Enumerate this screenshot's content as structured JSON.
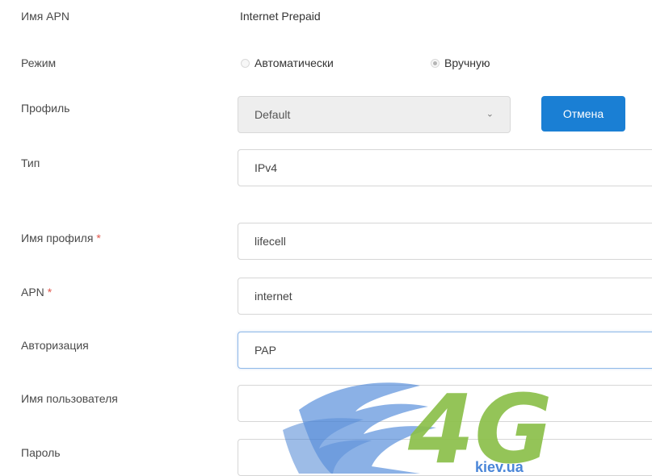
{
  "apn_name": {
    "label": "Имя APN",
    "value": "Internet Prepaid"
  },
  "mode": {
    "label": "Режим",
    "options": [
      {
        "label": "Автоматически",
        "checked": false
      },
      {
        "label": "Вручную",
        "checked": true
      }
    ]
  },
  "profile": {
    "label": "Профиль",
    "value": "Default",
    "disabled": true
  },
  "cancel_button": {
    "label": "Отмена"
  },
  "type": {
    "label": "Тип",
    "value": "IPv4"
  },
  "profile_name": {
    "label": "Имя профиля",
    "required_mark": "*",
    "value": "lifecell"
  },
  "apn": {
    "label": "APN",
    "required_mark": "*",
    "value": "internet"
  },
  "auth": {
    "label": "Авторизация",
    "value": "PAP"
  },
  "username": {
    "label": "Имя пользователя",
    "value": ""
  },
  "password": {
    "label": "Пароль",
    "value": ""
  },
  "watermark": {
    "text": "4G",
    "subtext": "kiev.ua"
  },
  "colors": {
    "accent": "#1a7fd4",
    "required": "#e0554a",
    "watermark_green": "#8cc04a",
    "watermark_blue": "#4a86d8"
  }
}
